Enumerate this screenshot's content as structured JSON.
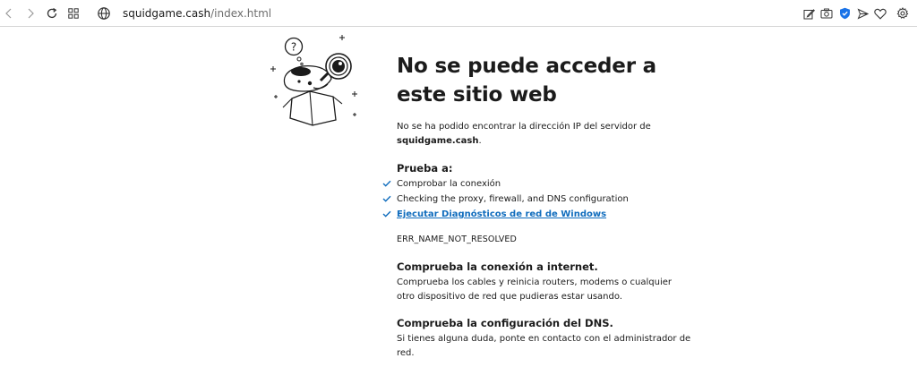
{
  "browser": {
    "url_host": "squidgame.cash",
    "url_path": "/index.html"
  },
  "page": {
    "title": "No se puede acceder a este sitio web",
    "description_prefix": "No se ha podido encontrar la dirección IP del servidor de",
    "description_host": "squidgame.cash",
    "description_suffix": ".",
    "try_heading": "Prueba a:",
    "try_items": [
      "Comprobar la conexión",
      "Checking the proxy, firewall, and DNS configuration",
      "Ejecutar Diagnósticos de red de Windows"
    ],
    "error_code": "ERR_NAME_NOT_RESOLVED",
    "sections": [
      {
        "heading": "Comprueba la conexión a internet.",
        "text": "Comprueba los cables y reinicia routers, modems o cualquier otro dispositivo de red que pudieras estar usando."
      },
      {
        "heading": "Comprueba la configuración del DNS.",
        "text": "Si tienes alguna duda, ponte en contacto con el administrador de red."
      }
    ]
  },
  "colors": {
    "accent": "#0f6cbd",
    "check": "#0f6cbd"
  },
  "icons": {
    "back": "back-arrow-icon",
    "forward": "forward-arrow-icon",
    "refresh": "refresh-icon",
    "tabs": "tab-grid-icon",
    "site_info": "globe-icon",
    "edit": "edit-icon",
    "screenshot": "camera-icon",
    "shield": "shield-icon",
    "send": "send-icon",
    "favorite": "heart-icon",
    "settings": "gear-icon"
  }
}
